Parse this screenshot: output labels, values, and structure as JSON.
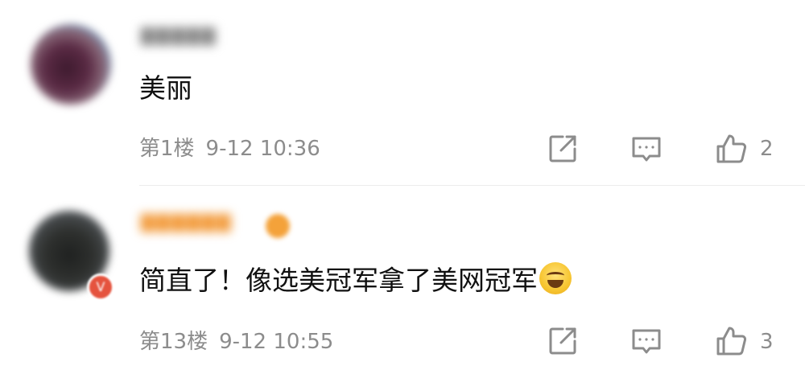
{
  "comments": [
    {
      "username": "▇▇▇▇▇",
      "content": "美丽",
      "floor": "第1楼",
      "time": "9-12 10:36",
      "likes": "2",
      "has_emoji": false
    },
    {
      "username": "▇▇▇▇▇▇",
      "content": "简直了！像选美冠军拿了美网冠军",
      "floor": "第13楼",
      "time": "9-12 10:55",
      "likes": "3",
      "has_emoji": true,
      "emoji": "face-with-tears-of-joy",
      "verified_badge": "V"
    }
  ],
  "colors": {
    "text": "#111111",
    "meta": "#8c8c8c",
    "username_vip": "#f29a3a",
    "badge_red": "#e5533e"
  },
  "icons": [
    "share-icon",
    "comment-icon",
    "like-icon"
  ]
}
